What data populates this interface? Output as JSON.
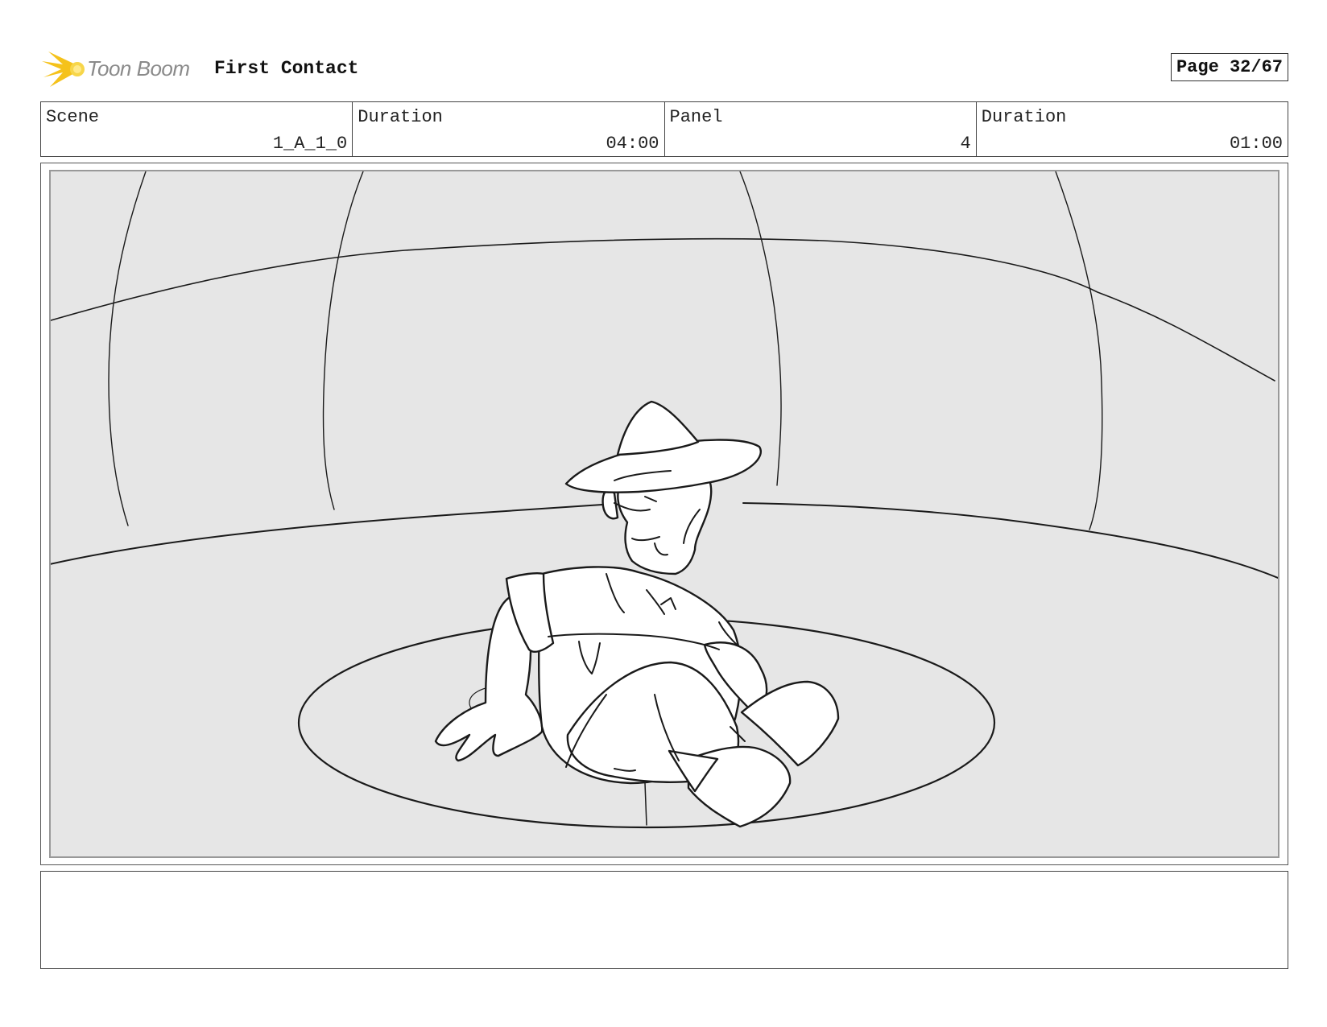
{
  "header": {
    "logo_text": "Toon Boom",
    "project_title": "First Contact",
    "page_label": "Page 32/67"
  },
  "info": {
    "scene_label": "Scene",
    "scene_value": "1_A_1_0",
    "scene_duration_label": "Duration",
    "scene_duration_value": "04:00",
    "panel_label": "Panel",
    "panel_value": "4",
    "panel_duration_label": "Duration",
    "panel_duration_value": "01:00"
  },
  "colors": {
    "logo_yellow": "#f5c21b",
    "panel_background": "#e6e6e6",
    "sketch_line": "#1a1a1a"
  },
  "icons": {
    "logo": "toon-boom-starburst-icon"
  },
  "notes": {
    "text": ""
  }
}
